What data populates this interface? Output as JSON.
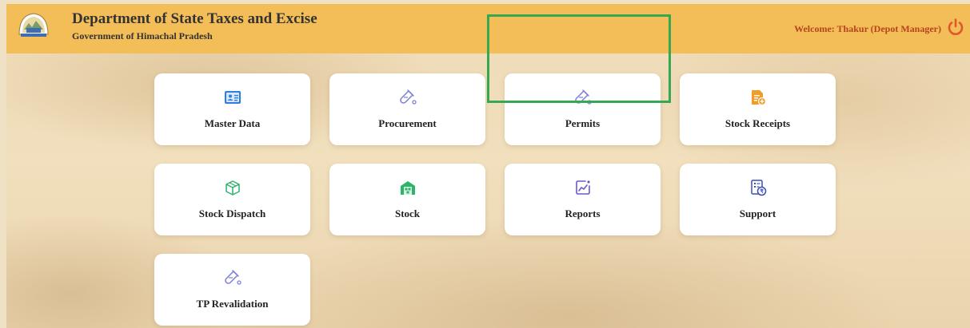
{
  "header": {
    "title": "Department of State Taxes and Excise",
    "subtitle": "Government of Himachal Pradesh",
    "welcome": "Welcome: Thakur (Depot Manager)",
    "emblem_icon": "state-emblem-icon",
    "logout_icon": "power-icon"
  },
  "colors": {
    "header_bg": "#f3bd58",
    "welcome_text": "#b5451c",
    "power_icon": "#e0582a",
    "highlight": "#36a852",
    "icon_blue": "#2f7de1",
    "icon_purple": "#7b7fd8",
    "icon_orange": "#f19b28",
    "icon_green": "#2db36a"
  },
  "tiles": [
    {
      "label": "Master Data",
      "icon": "id-card-icon"
    },
    {
      "label": "Procurement",
      "icon": "test-tube-icon"
    },
    {
      "label": "Permits",
      "icon": "test-tube-icon",
      "highlighted": true
    },
    {
      "label": "Stock Receipts",
      "icon": "add-document-icon"
    },
    {
      "label": "Stock Dispatch",
      "icon": "box-icon"
    },
    {
      "label": "Stock",
      "icon": "warehouse-icon"
    },
    {
      "label": "Reports",
      "icon": "chart-report-icon"
    },
    {
      "label": "Support",
      "icon": "rupee-document-icon"
    },
    {
      "label": "TP Revalidation",
      "icon": "test-tube-icon"
    }
  ]
}
